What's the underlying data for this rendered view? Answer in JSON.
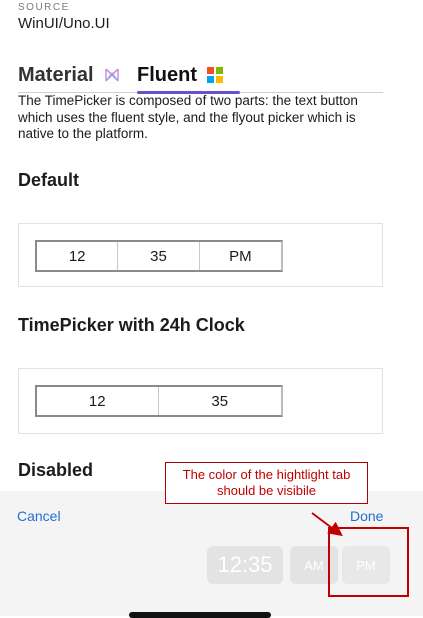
{
  "header": {
    "source_label": "SOURCE",
    "source_value": "WinUI/Uno.UI"
  },
  "tabs": [
    {
      "label": "Material",
      "icon": "material-logo-icon",
      "selected": false
    },
    {
      "label": "Fluent",
      "icon": "windows-logo-icon",
      "selected": true
    }
  ],
  "description": "The TimePicker is composed of two parts: the text button which uses the fluent style, and the flyout picker which is native to the platform.",
  "sections": [
    {
      "title": "Default",
      "picker": {
        "hour": "12",
        "minute": "35",
        "period": "PM"
      }
    },
    {
      "title": "TimePicker with 24h Clock",
      "picker": {
        "hour": "12",
        "minute": "35"
      }
    },
    {
      "title": "Disabled"
    }
  ],
  "flyout": {
    "cancel_label": "Cancel",
    "done_label": "Done",
    "time_value": "12:35",
    "am_label": "AM",
    "pm_label": "PM"
  },
  "annotation": {
    "callout_text": "The color of the hightlight tab should be visibile"
  },
  "colors": {
    "accent_underline": "#6b4fcf",
    "link_blue": "#1f6fd1",
    "annotation_red": "#c00000",
    "ms_red": "#f25022",
    "ms_green": "#7fba00",
    "ms_blue": "#00a4ef",
    "ms_yellow": "#ffb900"
  }
}
